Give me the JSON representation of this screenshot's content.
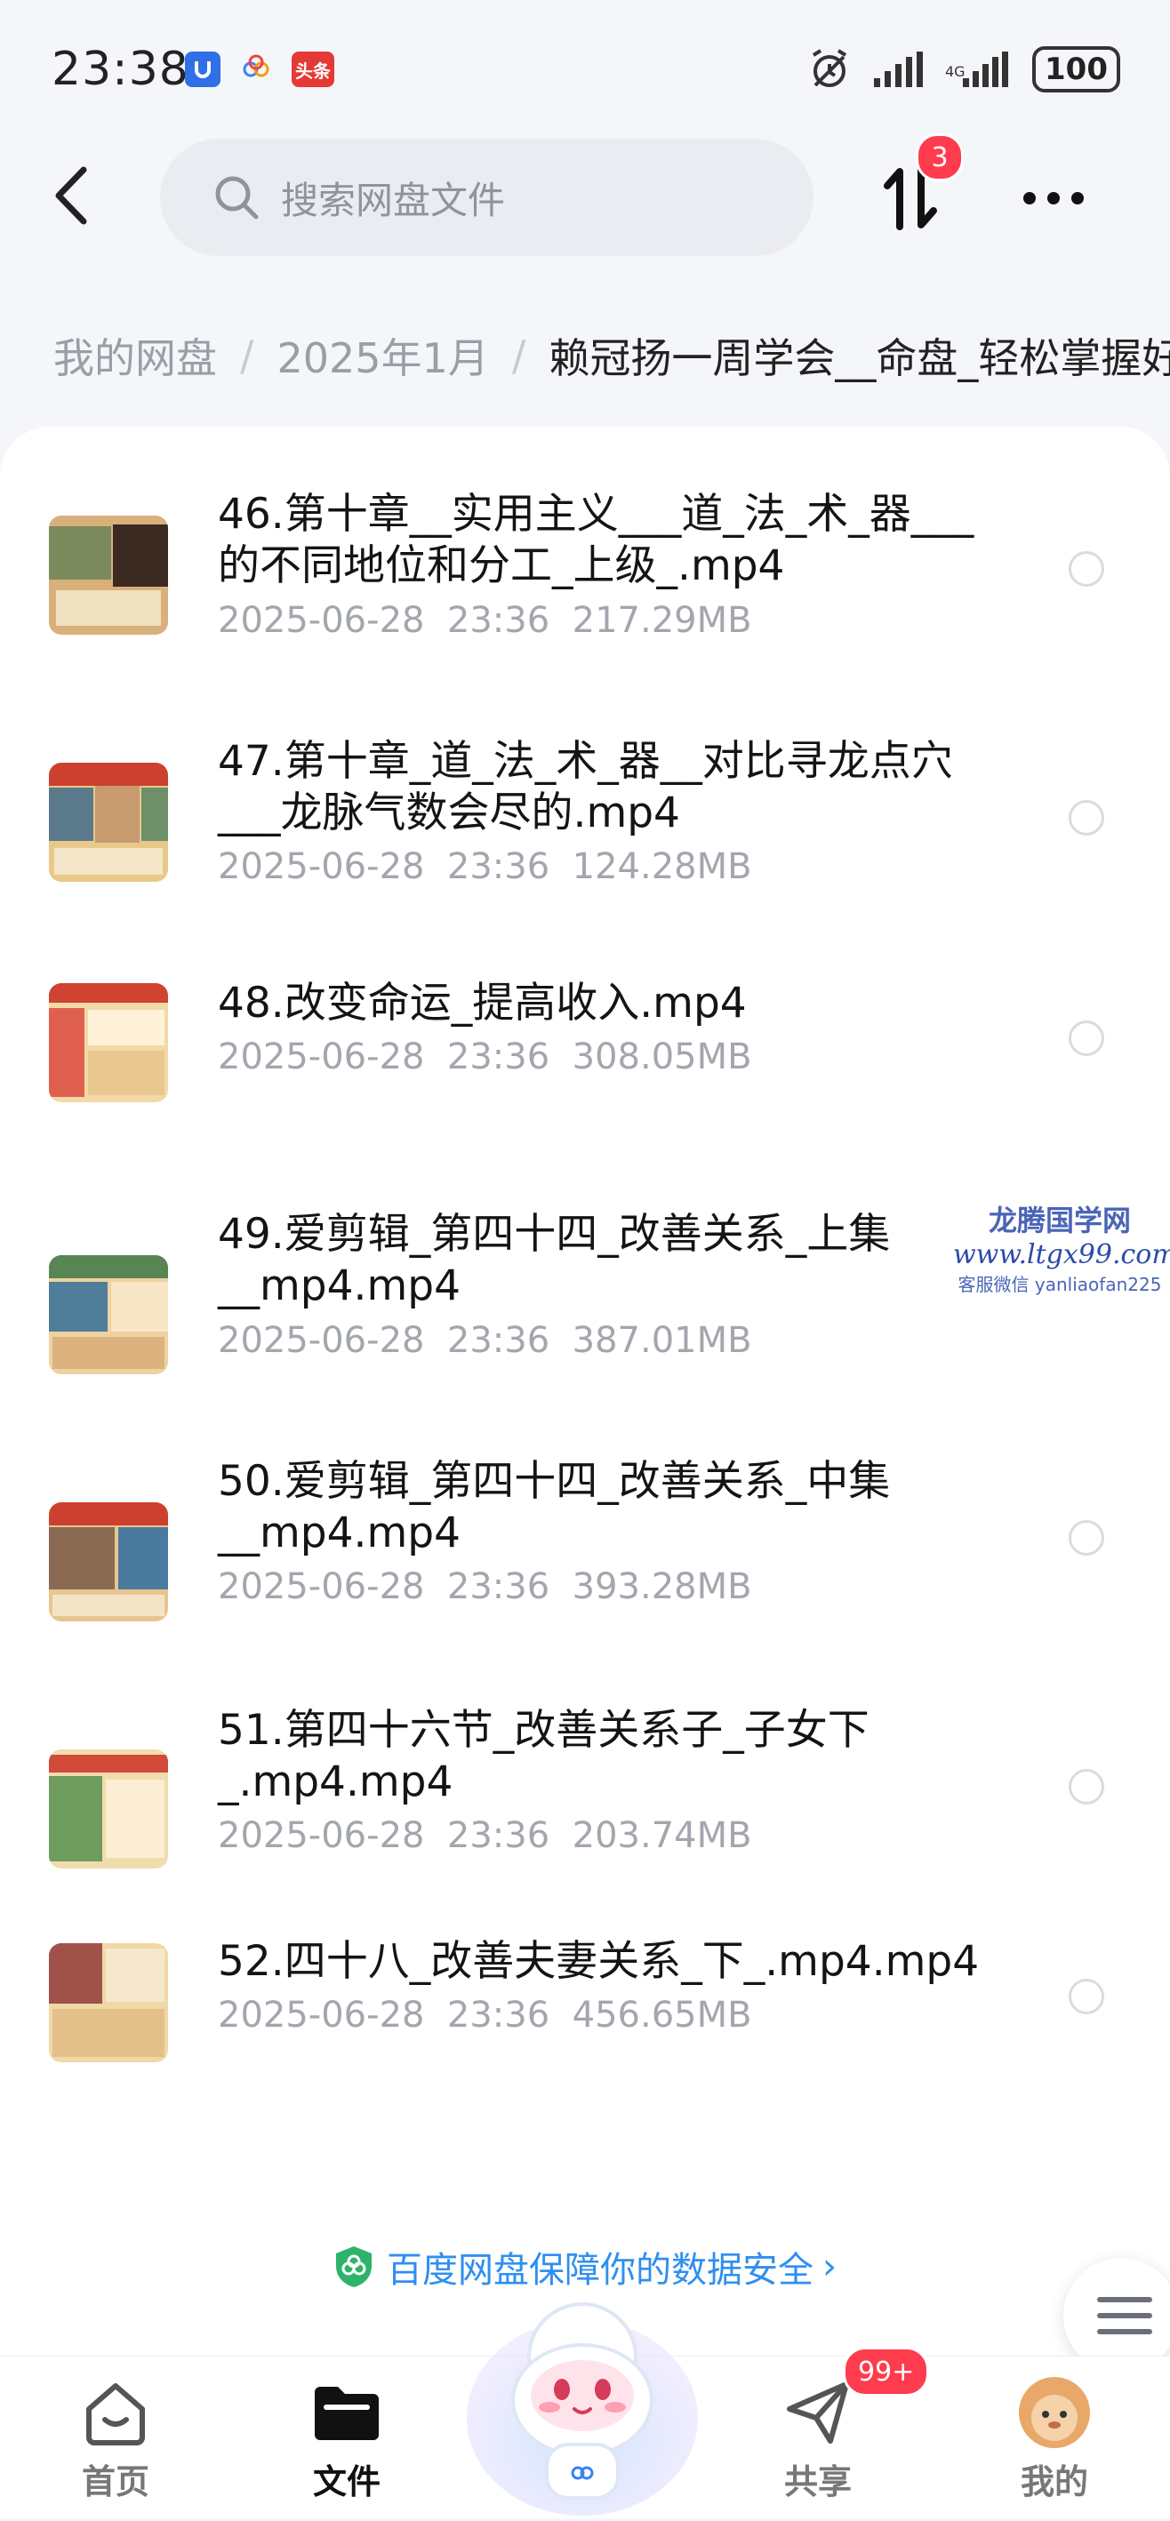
{
  "status_bar": {
    "time": "23:38",
    "app_icons": [
      "app-icon-blue",
      "app-icon-flower",
      "toutiao-icon"
    ],
    "toutiao_label": "头条",
    "alarm_icon": "alarm-icon",
    "signal_icons": [
      "signal-icon",
      "signal-icon"
    ],
    "battery": "100"
  },
  "top_bar": {
    "search_placeholder": "搜索网盘文件",
    "transfer_badge": "3"
  },
  "breadcrumb": {
    "items": [
      "我的网盘",
      "2025年1月"
    ],
    "current": "赖冠扬一周学会__命盘_轻松掌握好"
  },
  "files": [
    {
      "name": "46.第十章__实用主义___道_法_术_器___的不同地位和分工_上级_.mp4",
      "date": "2025-06-28",
      "time": "23:36",
      "size": "217.29MB"
    },
    {
      "name": "47.第十章_道_法_术_器__对比寻龙点穴___龙脉气数会尽的.mp4",
      "date": "2025-06-28",
      "time": "23:36",
      "size": "124.28MB"
    },
    {
      "name": "48.改变命运_提高收入.mp4",
      "date": "2025-06-28",
      "time": "23:36",
      "size": "308.05MB"
    },
    {
      "name": "49.爱剪辑_第四十四_改善关系_上集__mp4.mp4",
      "date": "2025-06-28",
      "time": "23:36",
      "size": "387.01MB"
    },
    {
      "name": "50.爱剪辑_第四十四_改善关系_中集__mp4.mp4",
      "date": "2025-06-28",
      "time": "23:36",
      "size": "393.28MB"
    },
    {
      "name": "51.第四十六节_改善关系子_子女下_.mp4.mp4",
      "date": "2025-06-28",
      "time": "23:36",
      "size": "203.74MB"
    },
    {
      "name": "52.四十八_改善夫妻关系_下_.mp4.mp4",
      "date": "2025-06-28",
      "time": "23:36",
      "size": "456.65MB"
    }
  ],
  "watermark": {
    "title": "龙腾国学网",
    "url": "www.ltgx99.com",
    "contact": "客服微信 yanliaofan225"
  },
  "security": {
    "text": "百度网盘保障你的数据安全",
    "chevron": "›"
  },
  "tabs": [
    {
      "label": "首页",
      "icon": "home-icon"
    },
    {
      "label": "文件",
      "icon": "folder-icon"
    },
    {
      "label": "共享",
      "icon": "share-icon"
    },
    {
      "label": "我的",
      "icon": "avatar-icon"
    }
  ],
  "share_badge": "99+",
  "colors": {
    "accent": "#2f8ff0",
    "badge": "#ff3b4e",
    "text_primary": "#141414",
    "text_secondary": "#a3a6ad"
  }
}
